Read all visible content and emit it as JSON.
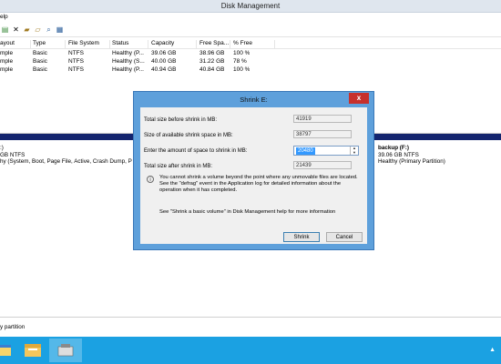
{
  "window": {
    "title": "Disk Management"
  },
  "menu": {
    "items": [
      {
        "label": "elp"
      }
    ]
  },
  "toolbar": {
    "icons": [
      "properties-icon",
      "delete-icon",
      "folder-icon",
      "open-folder-icon",
      "search-icon",
      "rescan-icon"
    ]
  },
  "volumes": {
    "columns": [
      "ayout",
      "Type",
      "File System",
      "Status",
      "Capacity",
      "Free Spa...",
      "% Free"
    ],
    "rows": [
      [
        "mple",
        "Basic",
        "NTFS",
        "Healthy (P...",
        "39.06 GB",
        "38.96 GB",
        "100 %"
      ],
      [
        "mple",
        "Basic",
        "NTFS",
        "Healthy (S...",
        "40.00 GB",
        "31.22 GB",
        "78 %"
      ],
      [
        "mple",
        "Basic",
        "NTFS",
        "Healthy (P...",
        "40.94 GB",
        "40.84 GB",
        "100 %"
      ]
    ]
  },
  "graphical": {
    "left_partition": {
      "name": ":)",
      "size": "GB NTFS",
      "status": "hy (System, Boot, Page File, Active, Crash Dump, P"
    },
    "right_partition": {
      "name": "backup (F:)",
      "size": "39.06 GB NTFS",
      "status": "Healthy (Primary Partition)"
    },
    "legend": "y partition"
  },
  "dialog": {
    "title": "Shrink E:",
    "close_label": "x",
    "total_before_label": "Total size before shrink in MB:",
    "total_before_value": "41919",
    "available_label": "Size of available shrink space in MB:",
    "available_value": "38797",
    "amount_label": "Enter the amount of space to shrink in MB:",
    "amount_value": "20480",
    "total_after_label": "Total size after shrink in MB:",
    "total_after_value": "21439",
    "info_icon": "i",
    "info_text": "You cannot shrink a volume beyond the point where any unmovable files are located. See the \"defrag\" event in the Application log for detailed information about the operation when it has completed.",
    "help_text": "See \"Shrink a basic volume\" in Disk Management help for more information",
    "shrink_button": "Shrink",
    "cancel_button": "Cancel"
  },
  "taskbar": {
    "tray_arrow": "▲"
  },
  "colors": {
    "taskbar": "#1ba1e2",
    "dialog_frame": "#5ea0db",
    "close": "#c7302c",
    "disk_bar": "#13246e"
  }
}
